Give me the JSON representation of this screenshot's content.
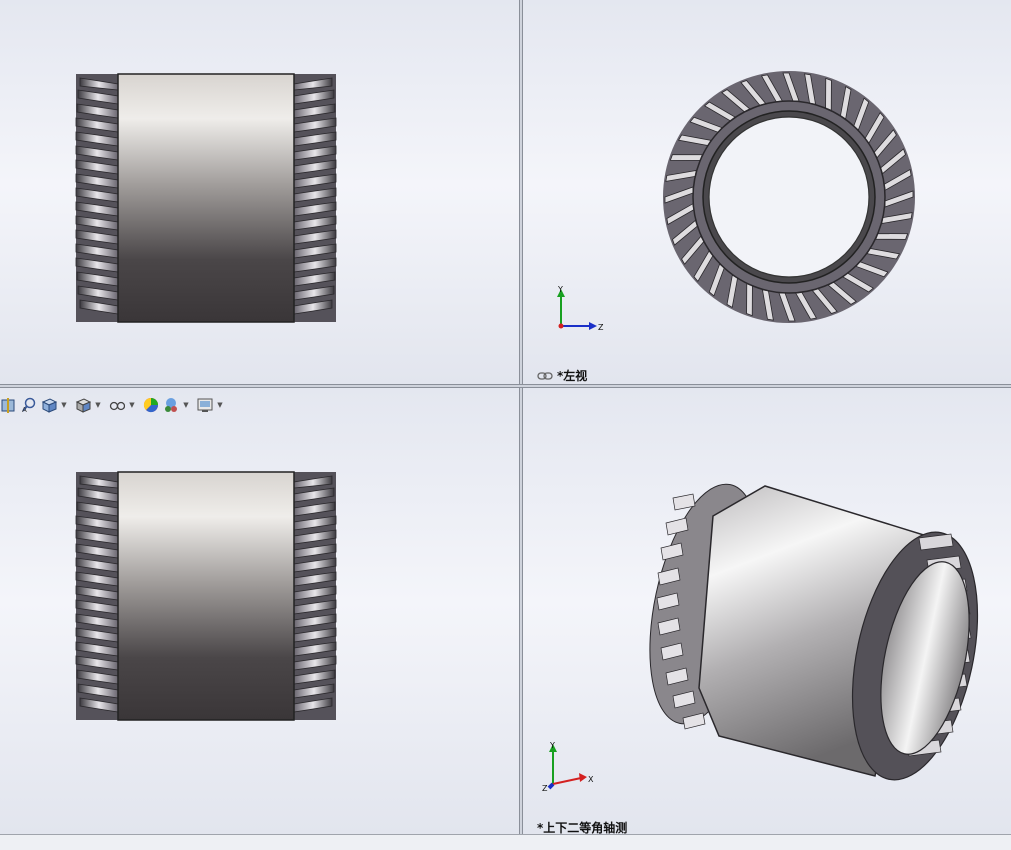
{
  "viewports": {
    "top_right": {
      "view_label": "*左视"
    },
    "bottom_right": {
      "view_label": "*上下二等角轴测"
    }
  },
  "heads_up_toolbar": {
    "icons": [
      "section-view-icon",
      "zoom-to-area-icon",
      "view-orientation-icon",
      "display-style-icon",
      "hide-show-items-icon",
      "edit-appearance-icon",
      "apply-scene-icon",
      "view-settings-icon"
    ]
  },
  "triad": {
    "x_label": "X",
    "y_label": "Y",
    "z_label": "Z"
  },
  "colors": {
    "axis_x": "#d42020",
    "axis_y": "#18a020",
    "axis_z": "#1a2fc8",
    "viewport_bg": "#eef0f6"
  }
}
